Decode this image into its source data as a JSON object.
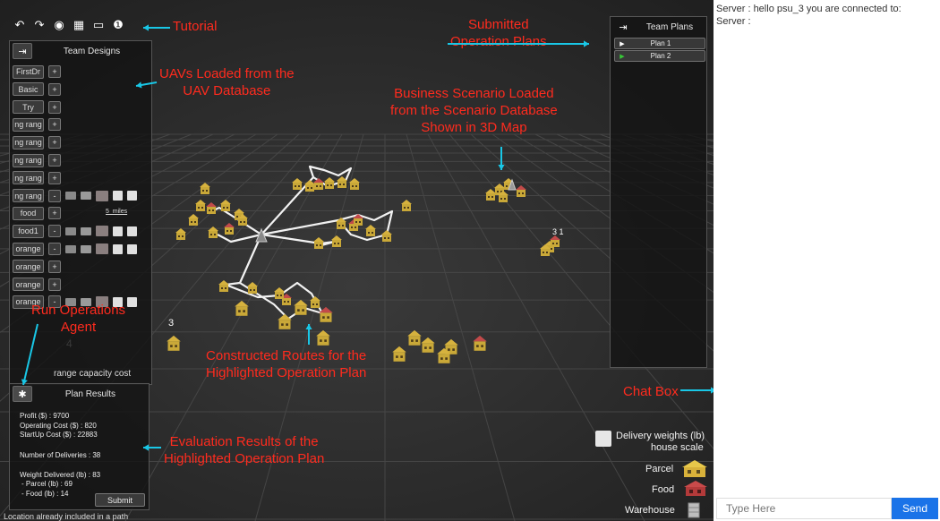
{
  "toolbar": {
    "buttons": [
      {
        "name": "undo",
        "glyph": "↶"
      },
      {
        "name": "redo",
        "glyph": "↷"
      },
      {
        "name": "database",
        "glyph": "◉"
      },
      {
        "name": "grid",
        "glyph": "▦"
      },
      {
        "name": "screen",
        "glyph": "▭"
      },
      {
        "name": "info",
        "glyph": "❶"
      }
    ]
  },
  "designs_panel": {
    "title": "Team Designs",
    "header_icon": "⇥",
    "items": [
      {
        "name": "FirstDr",
        "mode": "+"
      },
      {
        "name": "Basic",
        "mode": "+"
      },
      {
        "name": "Try",
        "mode": "+"
      },
      {
        "name": "ng rang",
        "mode": "+"
      },
      {
        "name": "ng rang",
        "mode": "+"
      },
      {
        "name": "ng rang",
        "mode": "+"
      },
      {
        "name": "ng rang",
        "mode": "+"
      },
      {
        "name": "ng rang",
        "mode": "-"
      },
      {
        "name": "food",
        "mode": "+"
      },
      {
        "name": "food1",
        "mode": "-"
      },
      {
        "name": "orange",
        "mode": "-"
      },
      {
        "name": "orange",
        "mode": "+"
      },
      {
        "name": "orange",
        "mode": "+"
      },
      {
        "name": "orange",
        "mode": "-"
      }
    ],
    "caption": "5_miles",
    "range_label": "range capacity cost"
  },
  "results_panel": {
    "title": "Plan Results",
    "profit": "Profit ($) : 9700",
    "operating_cost": "Operating Cost ($) : 820",
    "startup_cost": "StartUp Cost ($) : 22883",
    "deliveries": "Number of Deliveries : 38",
    "weight": "Weight Delivered (lb) : 83",
    "parcel": "- Parcel (lb) : 69",
    "food": "- Food  (lb) : 14",
    "submit_label": "Submit",
    "status": "Location already included in a path"
  },
  "plans_panel": {
    "title": "Team Plans",
    "plans": [
      {
        "name": "Plan 1",
        "arrow_color": "#ffffff"
      },
      {
        "name": "Plan 2",
        "arrow_color": "#37c837"
      }
    ]
  },
  "legend": {
    "title_line1": "Delivery weights (lb)",
    "title_line2": "house scale",
    "parcel": "Parcel",
    "food": "Food",
    "warehouse": "Warehouse"
  },
  "map_labels": {
    "ghost_a": "4",
    "ghost_b": "3",
    "cluster_right": "3 1"
  },
  "annotations": {
    "tutorial": "Tutorial",
    "submitted": "Submitted\nOperation Plans",
    "uavs": "UAVs Loaded from the\nUAV Database",
    "scenario": "Business Scenario Loaded\nfrom the Scenario Database\nShown in 3D Map",
    "run_agent": "Run Operations\nAgent",
    "routes": "Constructed Routes for the\nHighlighted Operation Plan",
    "chat": "Chat Box",
    "evaluation": "Evaluation Results of the\nHighlighted Operation Plan",
    "color": "#ff2b1e",
    "arrow_color": "#19c7e6"
  },
  "chat": {
    "messages": [
      "Server : hello psu_3 you are connected to:",
      "Server :"
    ],
    "input_placeholder": "Type Here",
    "send_label": "Send",
    "send_color": "#1a73e8"
  }
}
